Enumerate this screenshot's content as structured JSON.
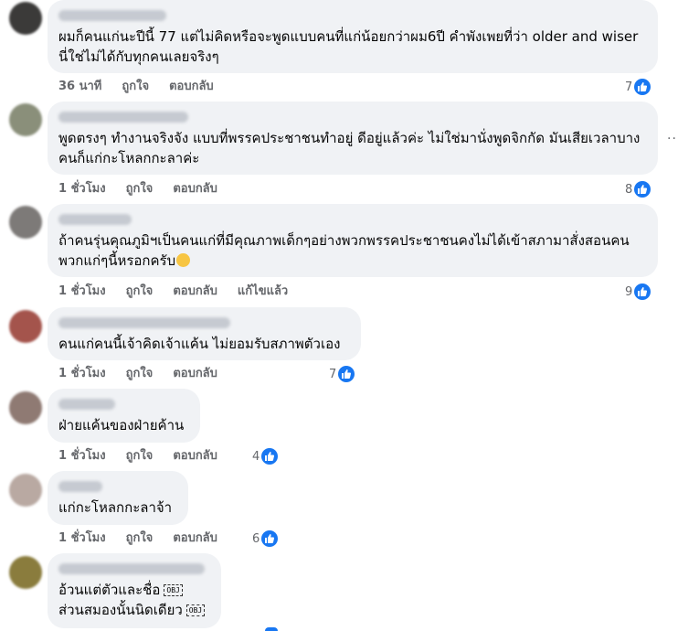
{
  "actions": {
    "like": "ถูกใจ",
    "reply": "ตอบกลับ",
    "edited": "แก้ไขแล้ว"
  },
  "more_options": "···",
  "comments": [
    {
      "text": "ผมก็คนแก่นะปีนี้ 77 แต่ไม่คิดหรือจะพูดแบบคนที่แก่น้อยกว่าผม6ปี คำพังเพยที่ว่า older and wiser นี่ใช่ไม่ได้กับทุกคนเลยจริงๆ",
      "time": "36 นาที",
      "likes": "7",
      "avatar_color": "#3b3a39"
    },
    {
      "text": "พูดตรงๆ ทำงานจริงจัง แบบที่พรรคประชาชนทำอยู่ ดีอยู่แล้วค่ะ ไม่ใช่มานั่งพูดจิกกัด มันเสียเวลาบางคนก็แก่กะโหลกกะลาค่ะ",
      "time": "1 ชั่วโมง",
      "likes": "8",
      "avatar_color": "#8a8f7a"
    },
    {
      "text": "ถ้าคนรุ่นคุณภูมิฯเป็นคนแก่ที่มีคุณภาพเด็กๆอย่างพวกพรรคประชาชนคงไม่ได้เข้าสภามาสั่งสอนคนพวกแก่ๆนี้หรอกครับ",
      "time": "1 ชั่วโมง",
      "likes": "9",
      "avatar_color": "#7d7a78"
    },
    {
      "text": "คนแก่คนนี้เจ้าคิดเจ้าแค้น ไม่ยอมรับสภาพตัวเอง",
      "time": "1 ชั่วโมง",
      "likes": "7",
      "avatar_color": "#a4544c"
    },
    {
      "text": "ฝ่ายแค้นของฝ่ายค้าน",
      "time": "1 ชั่วโมง",
      "likes": "4",
      "avatar_color": "#8f7a73"
    },
    {
      "text": "แก่กะโหลกกะลาจ้า",
      "time": "1 ชั่วโมง",
      "likes": "6",
      "avatar_color": "#b9a9a2"
    },
    {
      "text_line1": "อ้วนแต่ตัวและชื่อ",
      "text_line2": "ส่วนสมองนั้นนิดเดียว",
      "obj_label": "OBJ",
      "avatar_color": "#8a7c3d"
    }
  ]
}
